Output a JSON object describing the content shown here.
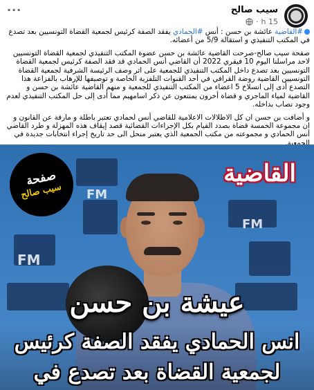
{
  "post": {
    "page_name": "سيب صالح",
    "time": "15 h",
    "body": {
      "hashtag1": "#القاضية",
      "line1_a": " عائشة بن حسن : أنس ",
      "hashtag2": "#الحمادي",
      "line1_b": " يفقد الصفة كرئيس لجمعية القضاة التونسيين بعد تصدع في المكتب التنفيذي و استقالة 5/9 من أعضائه.",
      "paragraph2": "صفحة سيب صالح-صرحت القاضية عائشة بن حسن عضوة المكتب التنفيذي لجمعية القضاة التونسيين لاحد مراسلنا اليوم 10 فيفري 2022 أن القاضي أنس الحمادي قد فقد الصفة كرئيس لجمعية القضاة التونسيين بعد تصدع داخل المكتب التنفيذي للجمعية على اثر وصف الرئيسة الشرفية لجمعية القضاة التونسيين القاضية روضة القرافي في أحد القنوات التلفزية الخاصة و توصيفها للإرهاب بالفزاعة هذا التصدع أدى إلى انسلاخ 5 اعضاء من المكتب التنفيذي للجمعية و منهم القاضية عائشة بن حسن و القاضية لمياء الماجري و قضاة أخرون يمتنعون عن ذكر اسامهيم مما أدى إلى حل المكتب التنفيذي لعدم وجود نصاب بداخله.",
      "paragraph3": "و أضافت بن حسن ان كل الاطلالات الاعلامية للقاضي أنس لحمادي تعتبر باطلة و مارقة عن القانون و ان مجموعة الخمسة قضاة بصدد القيام بكل الإجراءات القضائية قصد إيقاف هذه المهزلة و طرد القاضي أنس الحمادي و مجموعته من مكتب الجمعية الذي يعتبر منحل الى حد تاريخ إجراء انتخابات جديدة في الجمعية."
    },
    "image": {
      "logo_line1": "صفحة",
      "logo_line2": "سيب صالح",
      "tag": "القاضية",
      "name": "عيشة بن حسن",
      "headline1": "انس الحمادي يفقد الصفة كرئيس",
      "headline2": "لجمعية القضاة بعد تصدع في",
      "wall_text": "FM",
      "colors": {
        "wall": "#3a7dc0",
        "tag_outline": "#c0102a"
      }
    }
  }
}
